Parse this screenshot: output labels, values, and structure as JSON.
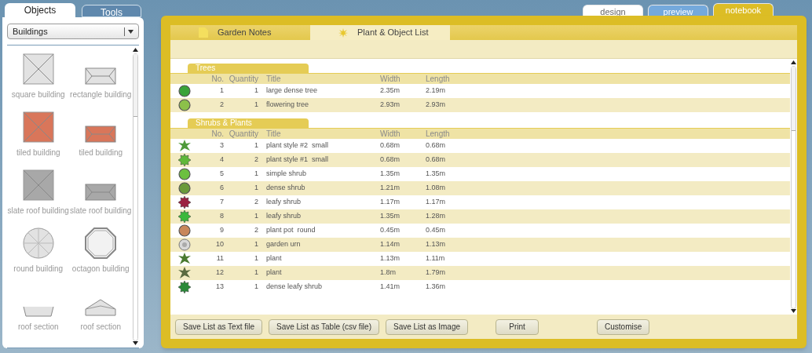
{
  "side_tabs": [
    {
      "label": "Objects",
      "selected": true
    },
    {
      "label": "Tools",
      "selected": false
    }
  ],
  "category_dropdown": {
    "value": "Buildings"
  },
  "objects": [
    {
      "label": "square building",
      "kind": "square",
      "color": "#e2e2e2"
    },
    {
      "label": "rectangle building",
      "kind": "rect",
      "color": "#e2e2e2"
    },
    {
      "label": "tiled building",
      "kind": "square",
      "color": "#d9765a"
    },
    {
      "label": "tiled building",
      "kind": "rect",
      "color": "#d9765a"
    },
    {
      "label": "slate roof building",
      "kind": "square",
      "color": "#a8a8a8"
    },
    {
      "label": "slate roof building",
      "kind": "rect",
      "color": "#a8a8a8"
    },
    {
      "label": "round building",
      "kind": "round",
      "color": "#e2e2e2"
    },
    {
      "label": "octagon building",
      "kind": "octagon",
      "color": "#f2f2f2"
    },
    {
      "label": "roof section",
      "kind": "flat",
      "color": "#e2e2e2"
    },
    {
      "label": "roof section",
      "kind": "peak",
      "color": "#e2e2e2"
    }
  ],
  "view_tabs": [
    {
      "label": "design",
      "selected": false,
      "color": "#ffffff"
    },
    {
      "label": "preview",
      "selected": false,
      "color": "#74a9dc"
    },
    {
      "label": "notebook",
      "selected": true,
      "color": "#dcbd25"
    }
  ],
  "notebook_tabs": [
    {
      "label": "Garden Notes",
      "kind": "page",
      "selected": false
    },
    {
      "label": "Plant & Object List",
      "kind": "star",
      "selected": true
    }
  ],
  "sections": [
    {
      "title": "Trees",
      "columns": [
        "No.",
        "Quantity",
        "Title",
        "Width",
        "Length"
      ],
      "rows": [
        {
          "kind": "circle",
          "color": "#3aa33a",
          "no": "1",
          "quantity": "1",
          "title": "large dense tree",
          "width": "2.35m",
          "length": "2.19m"
        },
        {
          "kind": "circle",
          "color": "#8cc04a",
          "no": "2",
          "quantity": "1",
          "title": "flowering tree",
          "width": "2.93m",
          "length": "2.93m"
        }
      ]
    },
    {
      "title": "Shrubs & Plants",
      "columns": [
        "No.",
        "Quantity",
        "Title",
        "Width",
        "Length"
      ],
      "rows": [
        {
          "kind": "star",
          "color": "#4f9a3a",
          "no": "3",
          "quantity": "1",
          "title": "plant style #2  small",
          "width": "0.68m",
          "length": "0.68m"
        },
        {
          "kind": "spiky",
          "color": "#5fb83a",
          "no": "4",
          "quantity": "2",
          "title": "plant style #1  small",
          "width": "0.68m",
          "length": "0.68m"
        },
        {
          "kind": "circle",
          "color": "#6cc040",
          "no": "5",
          "quantity": "1",
          "title": "simple shrub",
          "width": "1.35m",
          "length": "1.35m"
        },
        {
          "kind": "circle",
          "color": "#6a9a3a",
          "no": "6",
          "quantity": "1",
          "title": "dense shrub",
          "width": "1.21m",
          "length": "1.08m"
        },
        {
          "kind": "spiky",
          "color": "#9a2040",
          "no": "7",
          "quantity": "2",
          "title": "leafy shrub",
          "width": "1.17m",
          "length": "1.17m"
        },
        {
          "kind": "spiky",
          "color": "#3cb83c",
          "no": "8",
          "quantity": "1",
          "title": "leafy shrub",
          "width": "1.35m",
          "length": "1.28m"
        },
        {
          "kind": "pot",
          "color": "#c8875a",
          "no": "9",
          "quantity": "2",
          "title": "plant pot  round",
          "width": "0.45m",
          "length": "0.45m"
        },
        {
          "kind": "urn",
          "color": "#d8d8d8",
          "no": "10",
          "quantity": "1",
          "title": "garden urn",
          "width": "1.14m",
          "length": "1.13m"
        },
        {
          "kind": "star",
          "color": "#4a7a30",
          "no": "11",
          "quantity": "1",
          "title": "plant",
          "width": "1.13m",
          "length": "1.11m"
        },
        {
          "kind": "star",
          "color": "#5a6a40",
          "no": "12",
          "quantity": "1",
          "title": "plant",
          "width": "1.8m",
          "length": "1.79m"
        },
        {
          "kind": "spiky",
          "color": "#2a8a3a",
          "no": "13",
          "quantity": "1",
          "title": "dense leafy shrub",
          "width": "1.41m",
          "length": "1.36m"
        }
      ]
    }
  ],
  "buttons": [
    "Save List as Text file",
    "Save List as Table (csv file)",
    "Save List as Image",
    "Print",
    "Customise"
  ]
}
